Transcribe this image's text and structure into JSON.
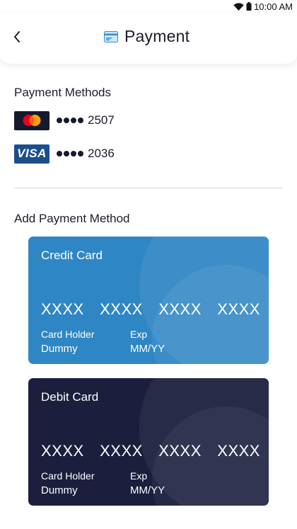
{
  "status_bar": {
    "time": "10:00 AM"
  },
  "header": {
    "title": "Payment"
  },
  "payment_methods": {
    "title": "Payment Methods",
    "items": [
      {
        "brand": "mastercard",
        "last4": "2507"
      },
      {
        "brand": "VISA",
        "last4": "2036"
      }
    ]
  },
  "add_method": {
    "title": "Add Payment Method",
    "cards": [
      {
        "type": "Credit Card",
        "number_groups": [
          "XXXX",
          "XXXX",
          "XXXX",
          "XXXX"
        ],
        "holder_label": "Card Holder",
        "holder_value": "Dummy",
        "exp_label": "Exp",
        "exp_value": "MM/YY"
      },
      {
        "type": "Debit Card",
        "number_groups": [
          "XXXX",
          "XXXX",
          "XXXX",
          "XXXX"
        ],
        "holder_label": "Card Holder",
        "holder_value": "Dummy",
        "exp_label": "Exp",
        "exp_value": "MM/YY"
      }
    ]
  },
  "colors": {
    "credit_card_bg": "#2f86c4",
    "debit_card_bg": "#1b1e3d",
    "visa_bg": "#1b4f8c",
    "mastercard_bg": "#151a2e",
    "mastercard_red": "#eb001b",
    "mastercard_orange": "#f79e1b"
  }
}
